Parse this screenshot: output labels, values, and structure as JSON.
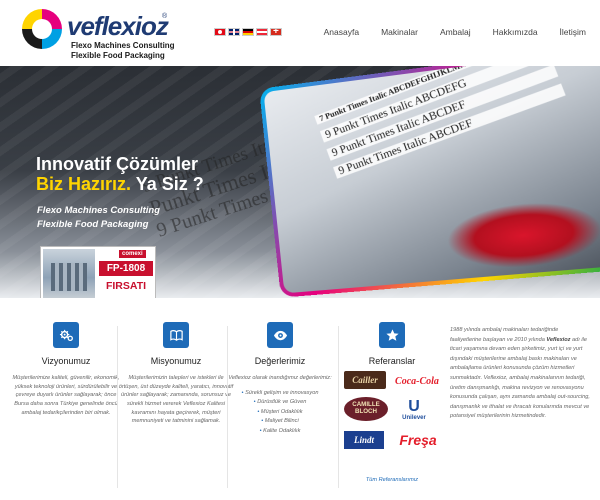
{
  "brand": {
    "name": "veflexioz",
    "registered": "®",
    "sub1": "Flexo Machines Consulting",
    "sub2": "Flexible Food Packaging"
  },
  "languages": [
    {
      "code": "tr",
      "name": "Turkish flag"
    },
    {
      "code": "gb",
      "name": "English flag"
    },
    {
      "code": "de",
      "name": "German flag"
    },
    {
      "code": "at",
      "name": "Austrian flag"
    },
    {
      "code": "ch",
      "name": "Swiss flag"
    }
  ],
  "nav": {
    "items": [
      "Anasayfa",
      "Makinalar",
      "Ambalaj",
      "Hakkımızda",
      "İletişim"
    ]
  },
  "hero": {
    "headline_line1": "Innovatif Çözümler",
    "headline_line2_highlight": "Biz Hazırız.",
    "headline_line2_rest": " Ya Siz ?",
    "tagline1": "Flexo Machines Consulting",
    "tagline2": "Flexible Food Packaging",
    "bg_line1": "9 Punkt Times Italic ABCDEFGHIJKLMNOP",
    "bg_line2": "Punkt Times Italic ABCDEFGH",
    "bg_line3": "9 Punkt Times Italic ABCDEF",
    "photo_line_small": "7 Punkt Times Italic ABCDEFGHIJKLMNOPQRSTUVWXYZ",
    "photo_line1": "9 Punkt Times Italic ABCDEFG",
    "photo_line2": "9 Punkt Times Italic ABCDEF",
    "photo_line3": "9 Punkt Times Italic ABCDEF",
    "promo_brand": "comexi",
    "promo_model": "FP-1808",
    "promo_label": "FIRSATI"
  },
  "features": {
    "vizyon": {
      "title": "Vizyonumuz",
      "text": "Müşterilerimize kaliteli, güvenilir, ekonomik, yüksek teknoloji ürünleri, sürdürülebilir ve çevreye duyarlı ürünler sağlayarak; önce Bursa daha sonra Türkiye genelinde öncü ambalaj tedarikçilerinden biri olmak."
    },
    "misyon": {
      "title": "Misyonumuz",
      "text": "Müşterilerimizin talepleri ve istekleri ile örtüşen, üst düzeyde kaliteli, yaratıcı, innovatif ürünler sağlayarak; zamanında, sorunsuz ve sürekli hizmet vererek Veflexioz Kalitesi kavramını hayata geçirerek, müşteri memnuniyeti ve tatminini sağlamak."
    },
    "deger": {
      "title": "Değerlerimiz",
      "intro": "Veflexioz olarak inandığımız değerlerimiz:",
      "items": [
        "Sürekli gelişim ve innovasyon",
        "Dürüstlük ve Güven",
        "Müşteri Odaklılık",
        "Maliyet Bilinci",
        "Kalite Odaklılık"
      ]
    },
    "referans": {
      "title": "Referanslar",
      "logos": [
        "Cailler",
        "Coca-Cola",
        "CAMILLE BLOCH",
        "Unilever",
        "Lindt",
        "Freşa"
      ],
      "link": "Tüm Referanslarımız"
    },
    "about": {
      "part1": "1988 yılında ambalaj makinaları tedariğinde faaliyetlerine başlayan ve 2010 yılında ",
      "brand": "Veflexioz",
      "part2": " adı ile ticari yaşamına devam eden şirketimiz, yurt içi ve yurt dışındaki müşterilerine ambalaj baskı makinaları ve ambalajlama ürünleri konusunda çözüm hizmetleri sunmaktadır. Veflexioz, ambalaj makinalarının tedariği, üretim danışmanlığı, makina revizyon ve renovasyonu konusunda çalışan, aynı zamanda ambalaj out-sourcing, danışmanlık ve ithalat ve ihracatı konularında mevcut ve potansiyel müşterilerinin hizmetindedir."
    }
  },
  "colors": {
    "accent": "#1e6bb8",
    "highlight": "#ffd400",
    "brand_blue": "#1f3b73"
  }
}
